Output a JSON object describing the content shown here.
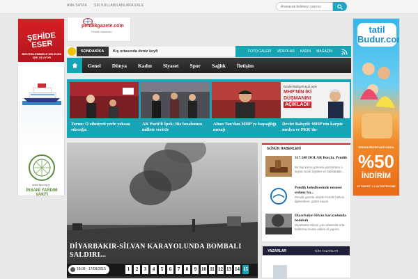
{
  "topbar": {
    "links": [
      "ANA SAYFA",
      "SIK KULLANILANLARA EKLE"
    ],
    "search_placeholder": "Aranacak kelimeyi yazınız"
  },
  "ads": {
    "left": {
      "title": "ŞEHİDE ESER",
      "subtitle": "BESTEKLENİNİZLE DELECEK IŞIK OLUYOR",
      "url": "www.iiyv.org.tr",
      "org": "İNSANİ YARDIM VAKFI"
    },
    "right": {
      "brand": "tatil Budur.com",
      "early": "ERKEN REZERVASYONDA",
      "discount": "%50",
      "indirim": "İNDİRİM",
      "taksit": "12 TAKSİT + 2 AY ERTELEME"
    }
  },
  "header": {
    "logo": {
      "brand": "pendikgazete.com",
      "tagline": "Pendik Haberleri"
    },
    "breaking": {
      "label": "SONDAKİKA",
      "text": "Kış ortasında deniz keyfi"
    },
    "subnav": [
      "FOTO GALERİ",
      "VİDEOLAR",
      "KADIN",
      "MAGAZİN"
    ],
    "nav": [
      "Genel",
      "Dünya",
      "Kadın",
      "Siyaset",
      "Spor",
      "Sağlık",
      "İletişim"
    ]
  },
  "headlines": [
    {
      "caption": "Torun: O zihniyeti yerle yeksan edeceğiz"
    },
    {
      "caption": "AK Parti'li İpek: Biz hesabımızı millete verirIz"
    },
    {
      "caption": "Altan Tan'dan MHP'ye başsağlığı mesajı"
    },
    {
      "caption": "Devlet Bahçeli: MHP'nin karşıtı medya ve PKK'dır",
      "img_text": [
        "Devlet Bahçeli açık açık",
        "MHP'NİN İKİ",
        "DÜŞMANINI",
        "AÇIKLADI!"
      ]
    }
  ],
  "feature": {
    "title": "DİYARBAKIR-SİLVAN KARAYOLUNDA BOMBALI SALDIRI...",
    "time": "18:08 - 17/09/2015",
    "pages": [
      "1",
      "2",
      "3",
      "4",
      "5",
      "6",
      "7",
      "8",
      "9",
      "10",
      "11",
      "12",
      "13",
      "14",
      "15"
    ],
    "active_page": "15"
  },
  "news": {
    "header": "GÜNÜN HABERLERİ",
    "items": [
      {
        "title": "317.500 DOLAR Borçla, Pendik",
        "desc": "Bir kişi kamu görevini yürütürken o kişinin ticari ilişkileri ve bakkaldaki..."
      },
      {
        "title": "Pendik belediyesinde nesnesi sedanz ba...",
        "desc": "Pendik gazete olarak Pendik halkını ilgilendiren, göste kaçan"
      },
      {
        "title": "Diyarbakır-Silvan karayolunda bombalı",
        "desc": "Diyarbakır-Silvan yolu arasında orta kaldırma monte edilen el yapımı"
      }
    ]
  },
  "writers": {
    "header": "YAZARLAR",
    "all_link": "TÜM YAZARLAR"
  }
}
